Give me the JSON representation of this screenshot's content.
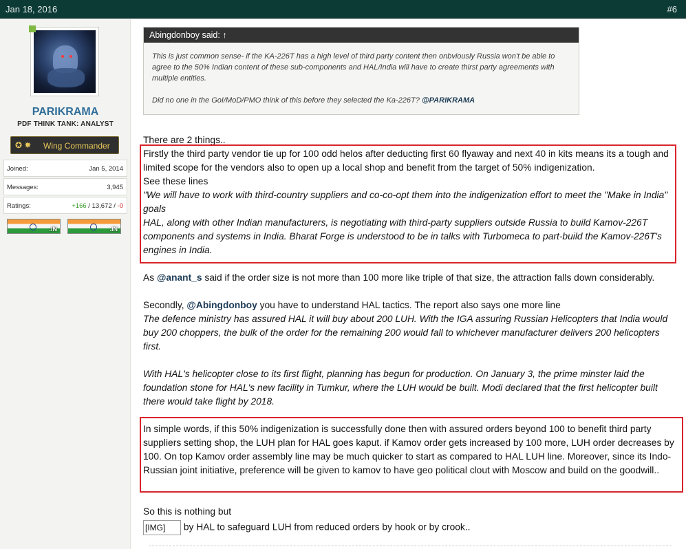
{
  "header": {
    "date": "Jan 18, 2016",
    "post_number": "#6"
  },
  "user": {
    "name": "PARIKRAMA",
    "title": "PDF THINK TANK: ANALYST",
    "rank": "Wing Commander",
    "stats": [
      {
        "key": "Joined:",
        "value": "Jan 5, 2014"
      },
      {
        "key": "Messages:",
        "value": "3,945"
      }
    ],
    "ratings": {
      "key": "Ratings:",
      "positive": "+166",
      "sep1": " / ",
      "neutral": "13,672",
      "sep2": " / ",
      "negative": "-0"
    },
    "flags": [
      ".IN",
      ".IN"
    ]
  },
  "quote": {
    "author": "Abingdonboy said: ↑",
    "text1": "This is just common sense- if the KA-226T has a high level of third party content then onbviously Russia won't be able to agree to the 50% Indian content of these sub-components and HAL/India will have to create thirst party agreements with multiple entities.",
    "text2": "Did no one in the GoI/MoD/PMO think of this before they selected the Ka-226T? ",
    "mention": "@PARIKRAMA"
  },
  "post": {
    "line_intro": "There are 2 things..",
    "block1_p1": "Firstly the third party vendor tie up for 100 odd helos after deducting first 60 flyaway and next 40 in kits means its a tough and limited scope for the vendors also to open up a local shop and benefit from the target of 50% indigenization.",
    "block1_p2": "See these lines",
    "block1_q1": "\"We will have to work with third-country suppliers and co-co-opt them into the indigenization effort to meet the \"Make in India\" goals",
    "block1_q2": "HAL, along with other Indian manufacturers, is negotiating with third-party suppliers outside Russia to build Kamov-226T components and systems in India. Bharat Forge is understood to be in talks with Turbomeca to part-build the Kamov-226T's engines in India.",
    "as_pre": "As ",
    "as_mention": "@anant_s",
    "as_post": " said if the order size is not more than 100 more like triple of that size, the attraction falls down considerably.",
    "second_pre": "Secondly, ",
    "second_mention": "@Abingdonboy",
    "second_post": " you have to understand HAL tactics. The report also says one more line",
    "second_q1": "The defence ministry has assured HAL it will buy about 200 LUH. With the IGA assuring Russian Helicopters that India would buy 200 choppers, the bulk of the order for the remaining 200 would fall to whichever manufacturer delivers 200 helicopters first.",
    "second_q2": "With HAL's helicopter close to its first flight, planning has begun for production. On January 3, the prime minster laid the foundation stone for HAL's new facility in Tumkur, where the LUH would be built. Modi declared that the first helicopter built there would take flight by 2018.",
    "block2": "In simple words, if this 50% indigenization is successfully done then with assured orders beyond 100 to benefit third party suppliers setting shop, the LUH plan for HAL goes kaput. if Kamov order gets increased by 100 more, LUH order decreases by 100. On top Kamov order assembly line may be much quicker to start as compared to HAL LUH line. Moreover, since its Indo-Russian joint initiative, preference will be given to kamov to have geo political clout with Moscow and build on the goodwill..",
    "so_line": "So this is nothing but",
    "img_alt": "[IMG]",
    "img_after": " by HAL to safeguard LUH from reduced orders by hook or by crook.."
  },
  "colors": {
    "header_bg": "#0c3b36",
    "username": "#2f6d9a",
    "highlight": "#d8242b",
    "mention": "#1d3b56"
  }
}
